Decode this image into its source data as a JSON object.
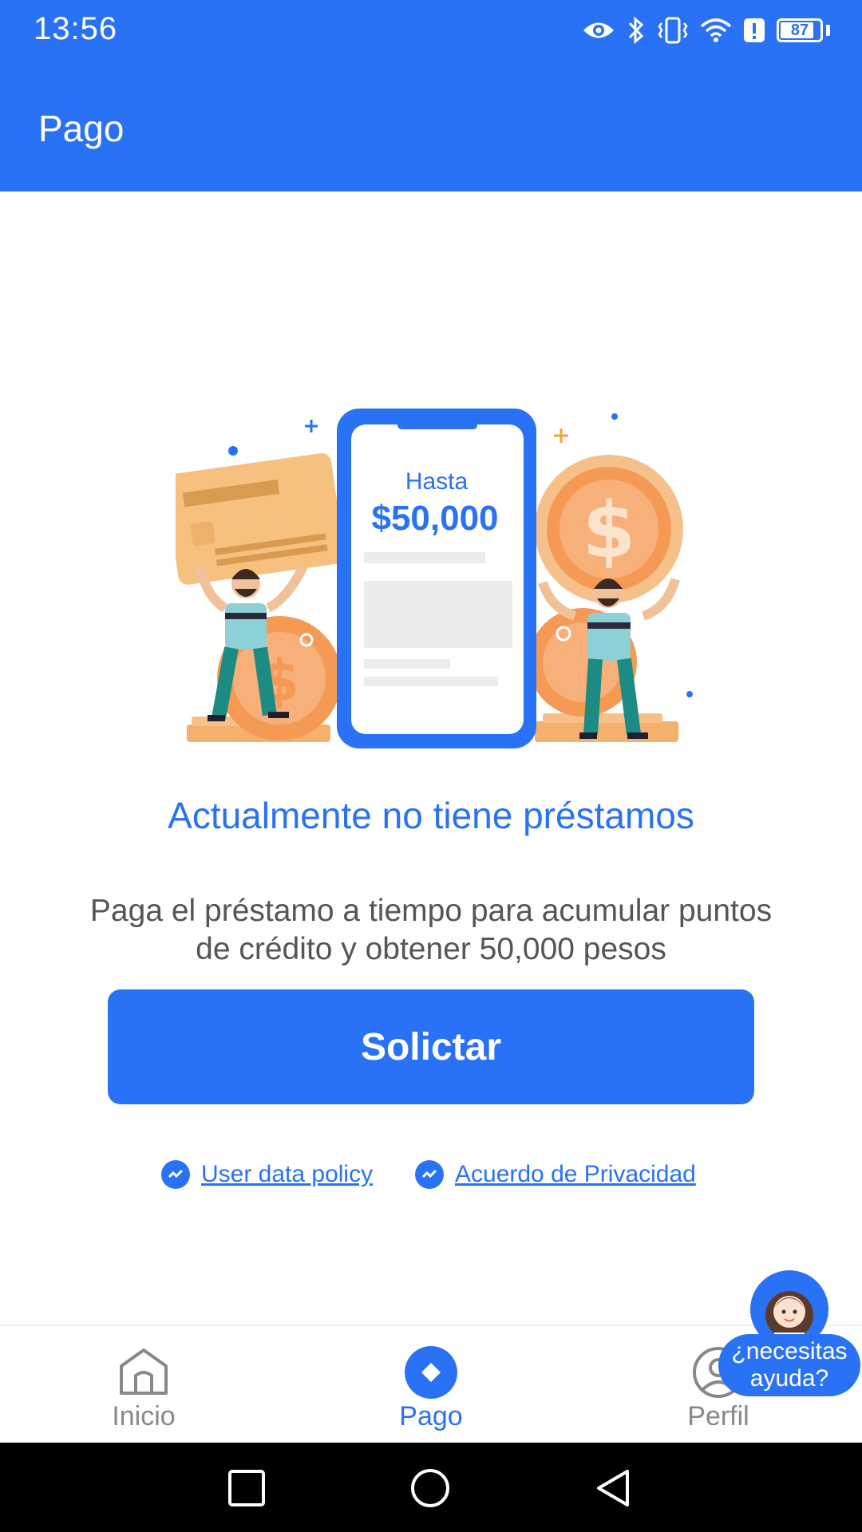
{
  "status_bar": {
    "time": "13:56",
    "battery": "87",
    "battery_level": 0.87
  },
  "app_bar": {
    "title": "Pago"
  },
  "hero": {
    "phone_label": "Hasta",
    "phone_amount": "$50,000"
  },
  "empty_state": {
    "title": "Actualmente no tiene préstamos",
    "description": "Paga el préstamo a tiempo para acumular puntos de crédito y obtener 50,000 pesos",
    "button_label": "Solictar"
  },
  "links": {
    "user_data_policy": "User data policy",
    "privacy_agreement": "Acuerdo de Privacidad"
  },
  "bottom_nav": {
    "items": [
      {
        "label": "Inicio",
        "icon": "home-icon",
        "active": false
      },
      {
        "label": "Pago",
        "icon": "payment-diamond-icon",
        "active": true
      },
      {
        "label": "Perfil",
        "icon": "profile-icon",
        "active": false
      }
    ]
  },
  "help": {
    "label": "¿necesitas ayuda?"
  },
  "colors": {
    "primary": "#2a72f5",
    "text_gray": "#555555",
    "nav_inactive": "#888888"
  }
}
